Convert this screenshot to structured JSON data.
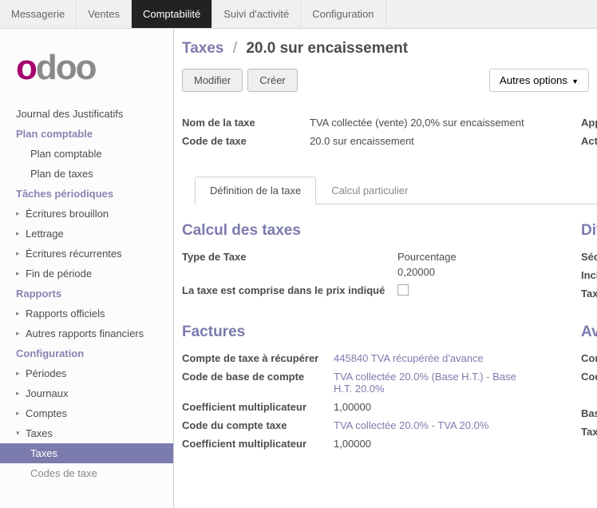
{
  "topnav": {
    "messaging": "Messagerie",
    "sales": "Ventes",
    "accounting": "Comptabilité",
    "activity": "Suivi d'activité",
    "config": "Configuration"
  },
  "logo": {
    "o": "o",
    "doo": "doo"
  },
  "sidebar": {
    "journal_justif": "Journal des Justificatifs",
    "plan_comptable_h": "Plan comptable",
    "plan_comptable": "Plan comptable",
    "plan_taxes": "Plan de taxes",
    "taches_h": "Tâches périodiques",
    "ecritures_brouillon": "Écritures brouillon",
    "lettrage": "Lettrage",
    "ecritures_rec": "Écritures récurrentes",
    "fin_periode": "Fin de période",
    "rapports_h": "Rapports",
    "rapports_off": "Rapports officiels",
    "autres_rapports": "Autres rapports financiers",
    "configuration_h": "Configuration",
    "periodes": "Périodes",
    "journaux": "Journaux",
    "comptes": "Comptes",
    "taxes": "Taxes",
    "taxes_sub": "Taxes",
    "codes_taxe": "Codes de taxe"
  },
  "breadcrumb": {
    "root": "Taxes",
    "current": "20.0 sur encaissement"
  },
  "buttons": {
    "modifier": "Modifier",
    "creer": "Créer",
    "options": "Autres options"
  },
  "header_fields": {
    "nom_label": "Nom de la taxe",
    "nom_val": "TVA collectée (vente) 20,0% sur encaissement",
    "code_label": "Code de taxe",
    "code_val": "20.0 sur encaissement",
    "applic": "Applic",
    "actif": "Actif"
  },
  "tabs": {
    "def": "Définition de la taxe",
    "calc": "Calcul particulier"
  },
  "calcul": {
    "title": "Calcul des taxes",
    "type_label": "Type de Taxe",
    "pct_label": "Pourcentage",
    "pct_val": "0,20000",
    "comprise_label": "La taxe est comprise dans le prix indiqué",
    "divers_title": "Diver",
    "sequen": "Séquen",
    "incluse": "Incluse",
    "taxe_su": "Taxe su"
  },
  "factures": {
    "title": "Factures",
    "avoirs": "Avoi",
    "compte_recup_label": "Compte de taxe à récupérer",
    "compte_recup_val": "445840 TVA récupérée d'avance",
    "code_base_label": "Code de base de compte",
    "code_base_val": "TVA collectée 20.0% (Base H.T.) - Base H.T. 20.0%",
    "coef_label": "Coefficient multiplicateur",
    "coef_val": "1,00000",
    "code_compte_label": "Code du compte taxe",
    "code_compte_val": "TVA collectée 20.0% - TVA 20.0%",
    "coef2_label": "Coefficient multiplicateur",
    "coef2_val": "1,00000",
    "compte_cut": "Compte",
    "code_p": "Code p",
    "base_c": "Base c",
    "taxe_c": "Taxe c"
  }
}
